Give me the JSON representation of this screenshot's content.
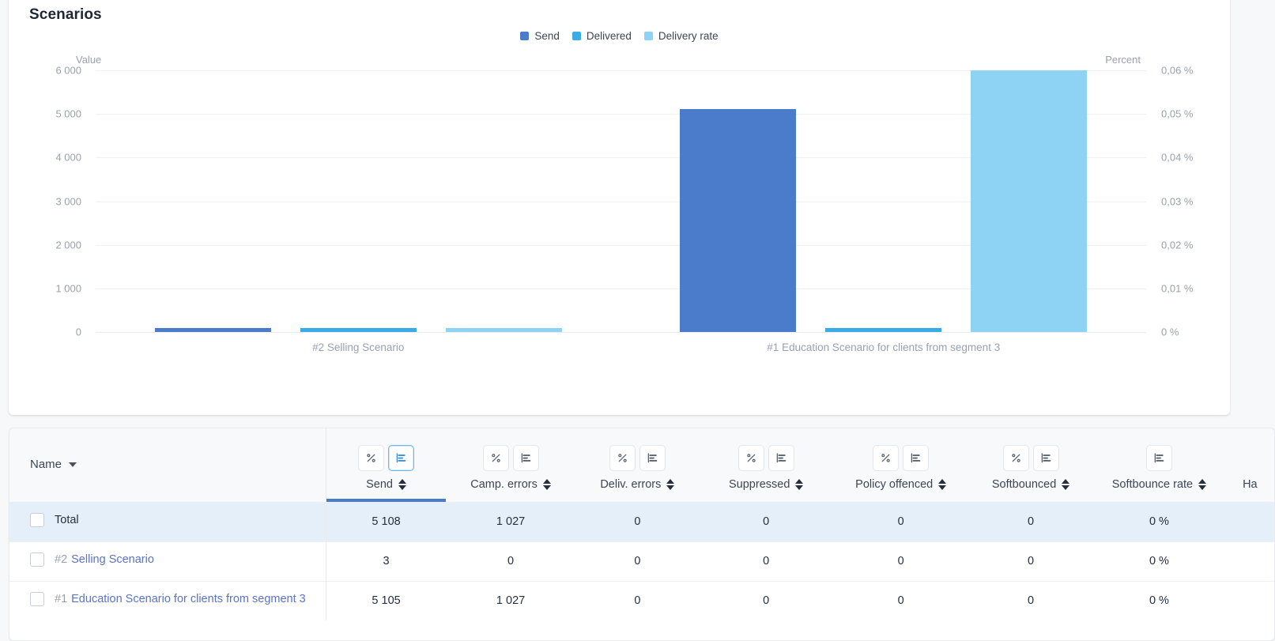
{
  "chart": {
    "title": "Scenarios",
    "left_axis_caption": "Value",
    "right_axis_caption": "Percent"
  },
  "chart_data": {
    "type": "bar",
    "title": "Scenarios",
    "xlabel": "",
    "ylabel": "Value",
    "y2label": "Percent",
    "ylim": [
      0,
      6000
    ],
    "y2lim": [
      0,
      0.06
    ],
    "grid": true,
    "legend_position": "top-center",
    "categories": [
      "#2 Selling Scenario",
      "#1 Education Scenario for clients from segment 3"
    ],
    "left_ticks": [
      "0",
      "1 000",
      "2 000",
      "3 000",
      "4 000",
      "5 000",
      "6 000"
    ],
    "right_ticks": [
      "0 %",
      "0,01 %",
      "0,02 %",
      "0,03 %",
      "0,04 %",
      "0,05 %",
      "0,06 %"
    ],
    "series": [
      {
        "name": "Send",
        "color": "#4a7ccb",
        "axis": "left",
        "values": [
          3,
          5105
        ]
      },
      {
        "name": "Delivered",
        "color": "#3babe8",
        "axis": "left",
        "values": [
          3,
          78
        ]
      },
      {
        "name": "Delivery rate",
        "color": "#8ed2f4",
        "axis": "right",
        "values": [
          0.0001,
          0.06
        ]
      }
    ]
  },
  "table": {
    "name_column": {
      "label": "Name"
    },
    "columns": [
      {
        "label": "Send",
        "toggles": [
          "percent-icon",
          "bar-chart-icon"
        ],
        "active_toggle": 1,
        "sortable": true,
        "active": true
      },
      {
        "label": "Camp. errors",
        "toggles": [
          "percent-icon",
          "bar-chart-icon"
        ],
        "active_toggle": -1,
        "sortable": true,
        "active": false
      },
      {
        "label": "Deliv. errors",
        "toggles": [
          "percent-icon",
          "bar-chart-icon"
        ],
        "active_toggle": -1,
        "sortable": true,
        "active": false
      },
      {
        "label": "Suppressed",
        "toggles": [
          "percent-icon",
          "bar-chart-icon"
        ],
        "active_toggle": -1,
        "sortable": true,
        "active": false
      },
      {
        "label": "Policy offenced",
        "toggles": [
          "percent-icon",
          "bar-chart-icon"
        ],
        "active_toggle": -1,
        "sortable": true,
        "active": false
      },
      {
        "label": "Softbounced",
        "toggles": [
          "percent-icon",
          "bar-chart-icon"
        ],
        "active_toggle": -1,
        "sortable": true,
        "active": false
      },
      {
        "label": "Softbounce rate",
        "toggles": [
          "bar-chart-icon"
        ],
        "active_toggle": -1,
        "sortable": true,
        "active": false
      },
      {
        "label": "Ha",
        "toggles": [],
        "active_toggle": -1,
        "sortable": false,
        "active": false
      }
    ],
    "rows": [
      {
        "id": "",
        "name": "Total",
        "is_total": true,
        "values": [
          "5 108",
          "1 027",
          "0",
          "0",
          "0",
          "0",
          "0 %"
        ]
      },
      {
        "id": "#2",
        "name": "Selling Scenario",
        "is_total": false,
        "values": [
          "3",
          "0",
          "0",
          "0",
          "0",
          "0",
          "0 %"
        ]
      },
      {
        "id": "#1",
        "name": "Education Scenario for clients from segment 3",
        "is_total": false,
        "values": [
          "5 105",
          "1 027",
          "0",
          "0",
          "0",
          "0",
          "0 %"
        ]
      }
    ]
  }
}
